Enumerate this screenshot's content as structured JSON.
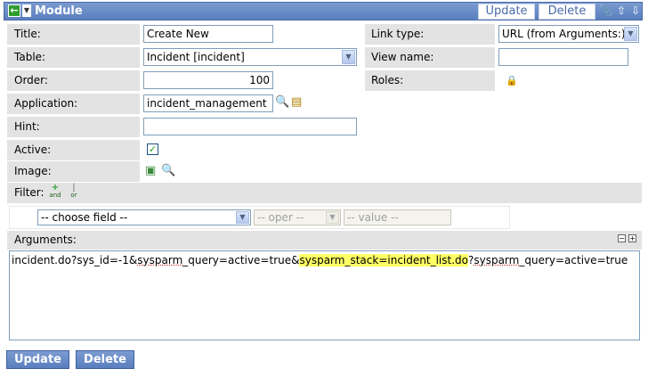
{
  "header": {
    "title": "Module",
    "update_label": "Update",
    "delete_label": "Delete"
  },
  "form": {
    "title_label": "Title:",
    "title_value": "Create New",
    "table_label": "Table:",
    "table_value": "Incident [incident]",
    "order_label": "Order:",
    "order_value": "100",
    "application_label": "Application:",
    "application_value": "incident_management",
    "hint_label": "Hint:",
    "hint_value": "",
    "active_label": "Active:",
    "active_checked": "✓",
    "image_label": "Image:",
    "link_type_label": "Link type:",
    "link_type_value": "URL (from Arguments:)",
    "view_name_label": "View name:",
    "view_name_value": "",
    "roles_label": "Roles:"
  },
  "filter": {
    "label": "Filter:",
    "and_label": "and",
    "or_label": "or",
    "field_placeholder": "-- choose field --",
    "oper_placeholder": "-- oper --",
    "value_placeholder": "-- value --"
  },
  "arguments": {
    "label": "Arguments:",
    "part1": "incident.do?sys_id=-1&",
    "part2": "sysparm",
    "part3": "_query=active=true&",
    "part4": "sysparm_stack=incident_list.do",
    "part5": "?",
    "part6": "sysparm",
    "part7": "_query=active=true"
  },
  "footer": {
    "update_label": "Update",
    "delete_label": "Delete"
  },
  "colors": {
    "header_bg": "#5a7ebf",
    "label_bg": "#e3e3e3",
    "highlight": "#ffff66"
  }
}
